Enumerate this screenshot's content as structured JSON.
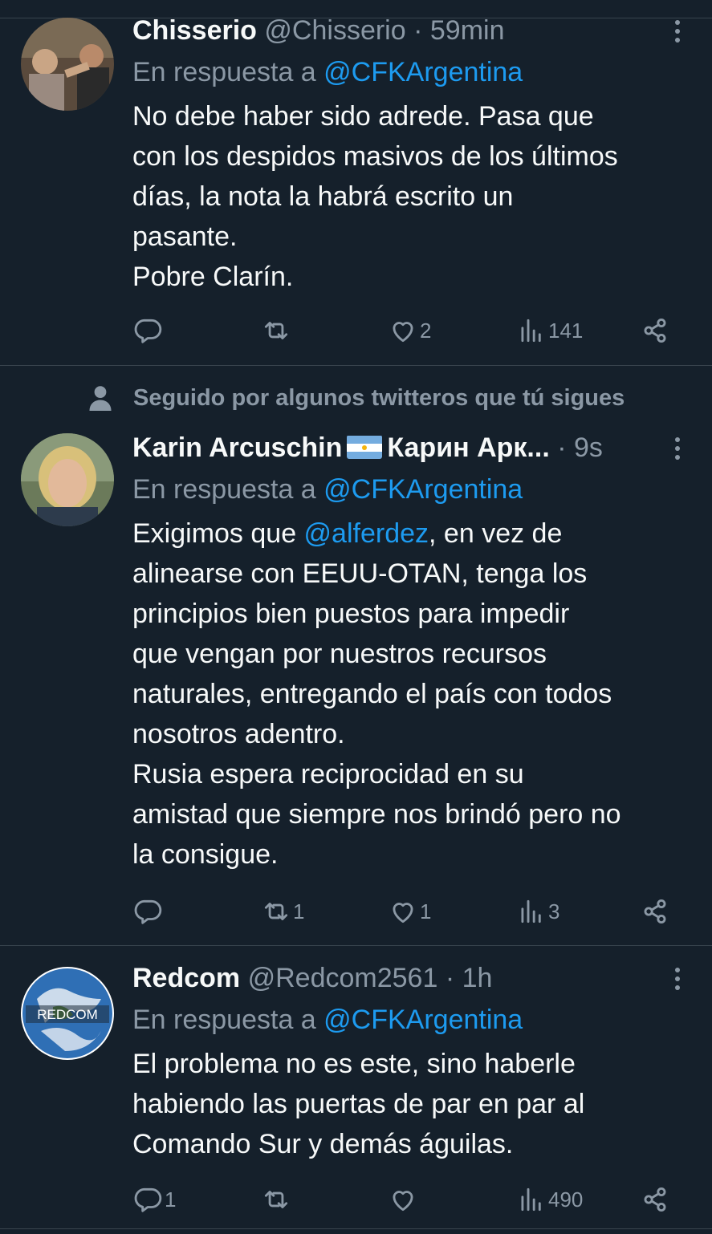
{
  "tweets": [
    {
      "name": "Chisserio",
      "handle": "@Chisserio",
      "separator": "·",
      "time": "59min",
      "reply_prefix": "En respuesta a",
      "reply_to": "@CFKArgentina",
      "lines": [
        "No debe haber sido adrede. Pasa que",
        "con los despidos masivos de los últimos",
        "días, la nota la habrá escrito un",
        "pasante.",
        "Pobre Clarín."
      ],
      "stats": {
        "replies": "",
        "retweets": "",
        "likes": "2",
        "views": "141"
      }
    },
    {
      "social_context": "Seguido por algunos twitteros que tú sigues",
      "name_part1": "Karin Arcuschin",
      "name_part2": "Карин Арк...",
      "separator": "·",
      "time": "9s",
      "reply_prefix": "En respuesta a",
      "reply_to": "@CFKArgentina",
      "line1_prefix": "Exigimos que ",
      "line1_mention": "@alferdez",
      "line1_suffix": ", en vez de",
      "lines": [
        "alinearse con EEUU-OTAN, tenga los",
        "principios bien puestos para impedir",
        "que vengan por nuestros recursos",
        "naturales, entregando el país con todos",
        "nosotros adentro.",
        "Rusia espera reciprocidad en su",
        "amistad que siempre nos brindó pero no",
        "la consigue."
      ],
      "stats": {
        "replies": "",
        "retweets": "1",
        "likes": "1",
        "views": "3"
      }
    },
    {
      "name": "Redcom",
      "handle": "@Redcom2561",
      "separator": "·",
      "time": "1h",
      "avatar_text": "REDCOM",
      "reply_prefix": "En respuesta a",
      "reply_to": "@CFKArgentina",
      "lines": [
        "El problema no es este, sino haberle",
        "habiendo las puertas de par en par al",
        "Comando Sur y demás águilas."
      ],
      "stats": {
        "replies": "1",
        "retweets": "",
        "likes": "",
        "views": "490"
      }
    }
  ],
  "icons": [
    "reply-icon",
    "retweet-icon",
    "like-icon",
    "views-icon",
    "share-icon",
    "more-icon",
    "person-icon",
    "argentina-flag-icon"
  ],
  "colors": {
    "background": "#15202b",
    "text": "#f7f9f9",
    "secondary": "#8b98a5",
    "link": "#1d9bf0",
    "border": "#38444d"
  }
}
